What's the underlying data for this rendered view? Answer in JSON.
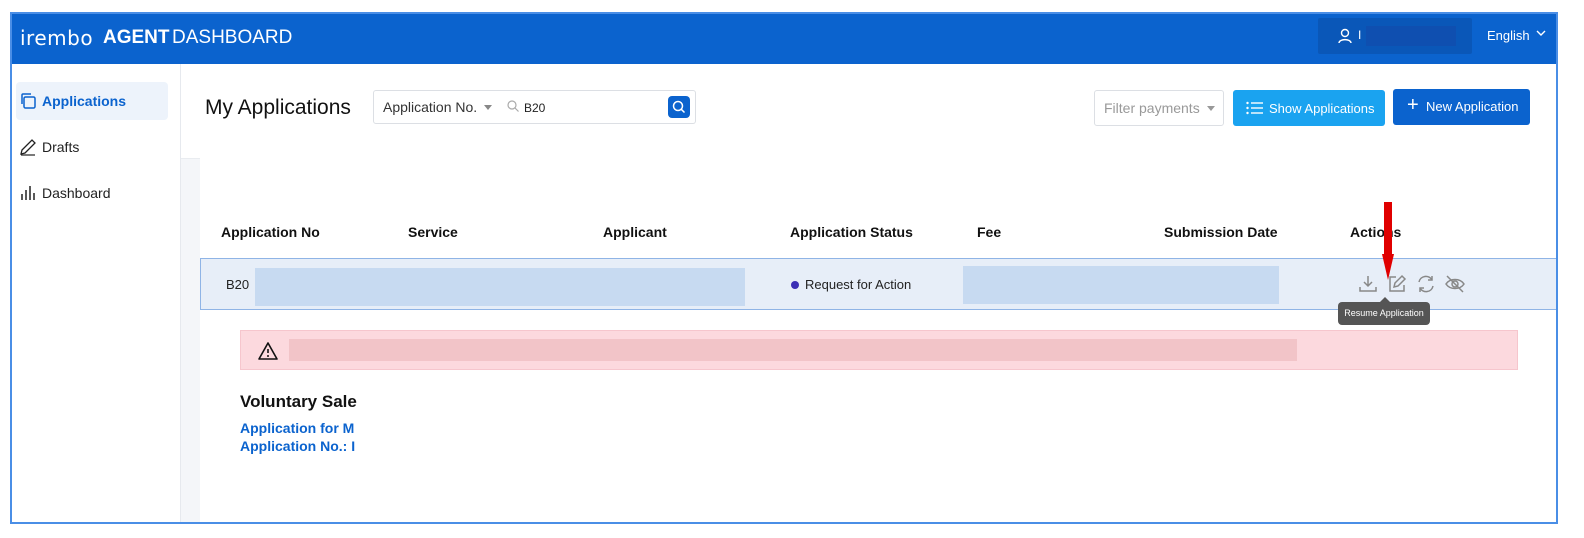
{
  "header": {
    "brand": "irembo",
    "title_strong": "AGENT",
    "title_rest": " DASHBOARD",
    "user_initial": "I",
    "language": "English"
  },
  "sidebar": {
    "items": [
      {
        "label": "Applications",
        "icon": "copy-icon",
        "active": true
      },
      {
        "label": "Drafts",
        "icon": "pencil-icon",
        "active": false
      },
      {
        "label": "Dashboard",
        "icon": "bar-chart-icon",
        "active": false
      }
    ]
  },
  "toolbar": {
    "page_title": "My Applications",
    "search_field_select": "Application No.",
    "search_value": "B20",
    "filter_placeholder": "Filter payments",
    "show_applications_label": "Show Applications",
    "new_application_label": "New Application"
  },
  "table": {
    "columns": [
      "Application No",
      "Service",
      "Applicant",
      "Application Status",
      "Fee",
      "Submission Date",
      "Actions"
    ],
    "rows": [
      {
        "application_no": "B20",
        "status": "Request for Action",
        "status_color": "#3b2fb5"
      }
    ],
    "actions": [
      "download-icon",
      "edit-icon",
      "refresh-icon",
      "hide-icon"
    ],
    "tooltip": "Resume Application"
  },
  "detail": {
    "service_title": "Voluntary Sale",
    "link_application_for": "Application for M",
    "link_application_no": "Application No.: I"
  },
  "colors": {
    "brand_blue": "#0b63ce",
    "show_button": "#1aa3f0",
    "alert_bg": "#fcd9de",
    "annotation_arrow": "#e00000"
  }
}
